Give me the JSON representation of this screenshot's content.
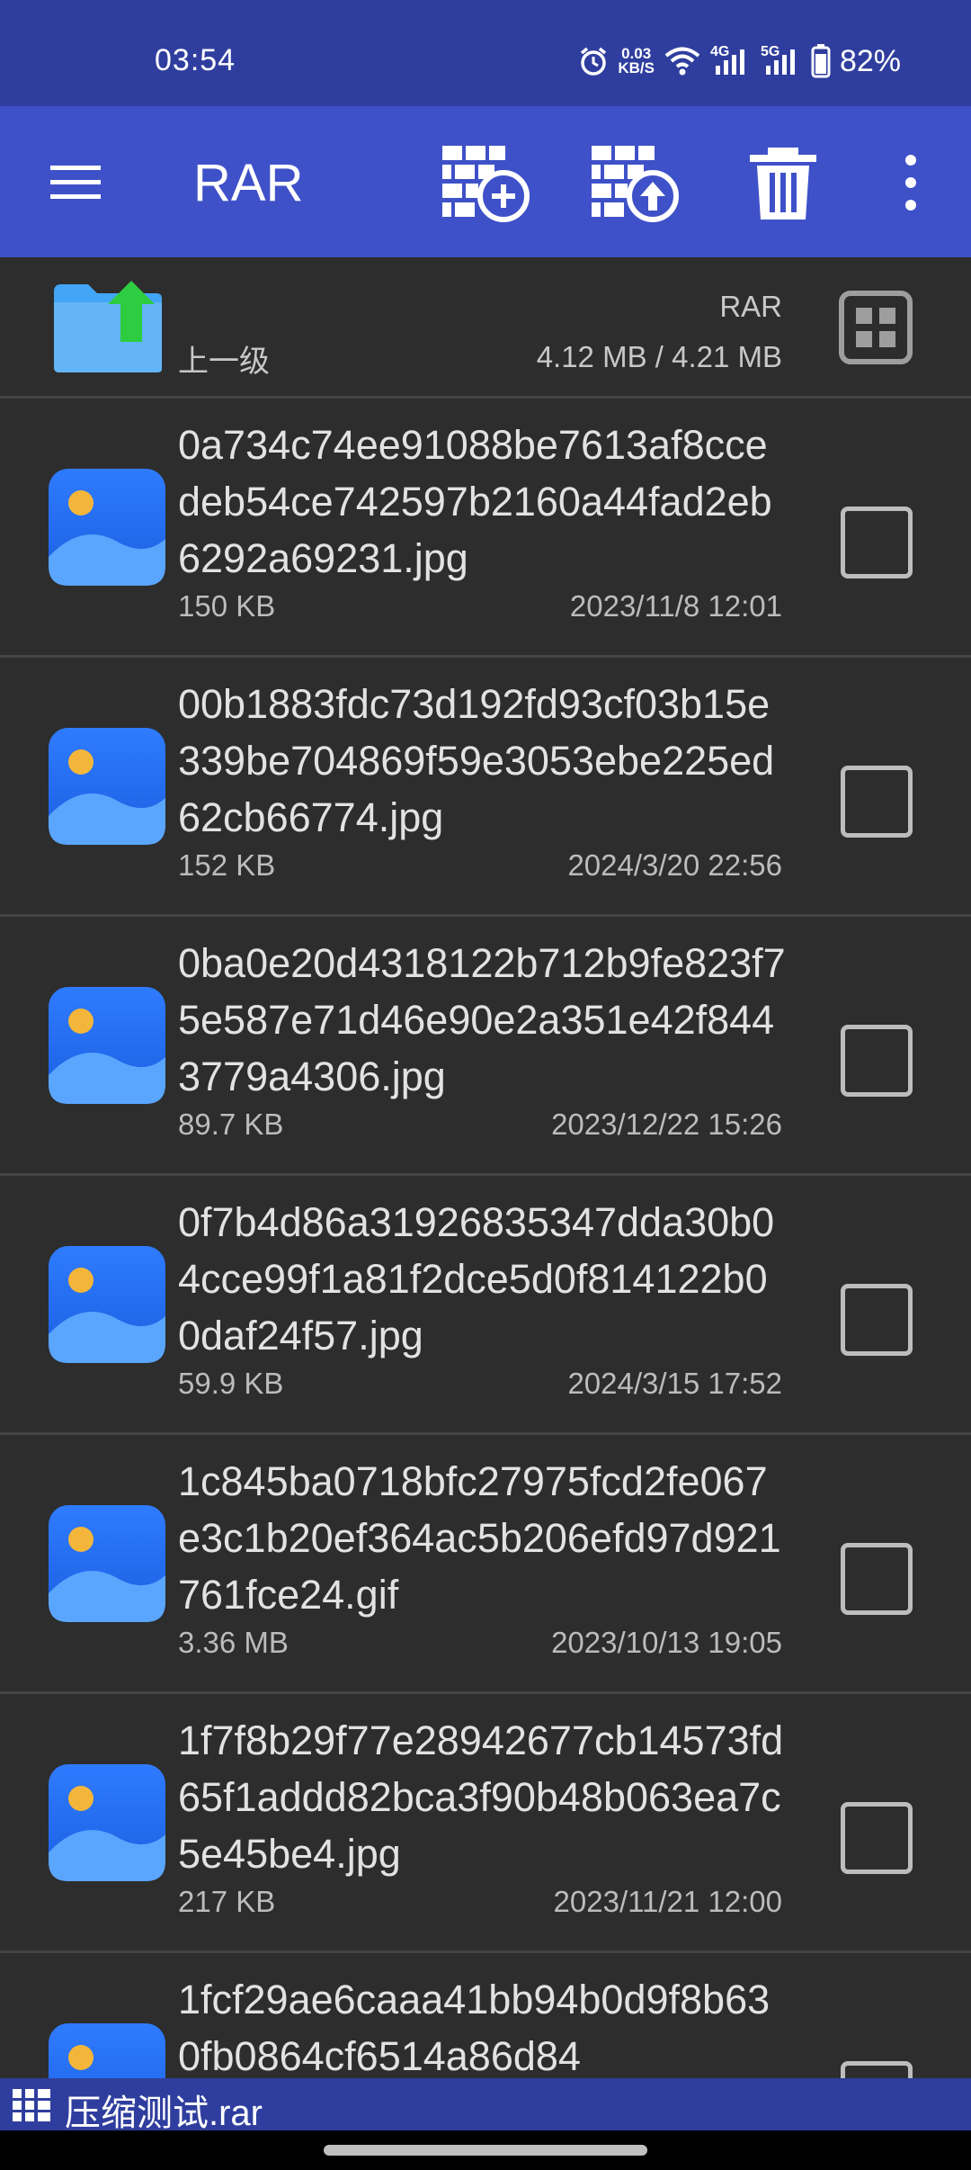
{
  "status": {
    "time": "03:54",
    "net_speed_value": "0.03",
    "net_speed_unit": "KB/S",
    "net_4g": "4G",
    "net_5g": "5G",
    "battery": "82%"
  },
  "toolbar": {
    "title": "RAR",
    "icons": [
      "menu-icon",
      "add-to-archive-icon",
      "extract-icon",
      "delete-icon",
      "more-icon"
    ]
  },
  "parent": {
    "label": "上一级",
    "archive_name": "RAR",
    "sizes": "4.12 MB / 4.21 MB"
  },
  "files": [
    {
      "name": "0a734c74ee91088be7613af8ccedeb54ce742597b2160a44fad2eb6292a69231.jpg",
      "size": "150 KB",
      "date": "2023/11/8 12:01"
    },
    {
      "name": "00b1883fdc73d192fd93cf03b15e339be704869f59e3053ebe225ed62cb66774.jpg",
      "size": "152 KB",
      "date": "2024/3/20 22:56"
    },
    {
      "name": "0ba0e20d4318122b712b9fe823f75e587e71d46e90e2a351e42f8443779a4306.jpg",
      "size": "89.7 KB",
      "date": "2023/12/22 15:26"
    },
    {
      "name": "0f7b4d86a31926835347dda30b04cce99f1a81f2dce5d0f814122b00daf24f57.jpg",
      "size": "59.9 KB",
      "date": "2024/3/15 17:52"
    },
    {
      "name": "1c845ba0718bfc27975fcd2fe067e3c1b20ef364ac5b206efd97d921761fce24.gif",
      "size": "3.36 MB",
      "date": "2023/10/13 19:05"
    },
    {
      "name": "1f7f8b29f77e28942677cb14573fd65f1addd82bca3f90b48b063ea7c5e45be4.jpg",
      "size": "217 KB",
      "date": "2023/11/21 12:00"
    },
    {
      "name": "1fcf29ae6caaa41bb94b0d9f8b630fb0864cf6514a86d84",
      "size": "",
      "date": ""
    }
  ],
  "bottom": {
    "archive_path": "压缩测试.rar"
  },
  "colors": {
    "status_bar": "#2f3e9e",
    "toolbar": "#3f51c8",
    "background": "#2d2d2d",
    "folder": "#42a5f5",
    "folder_arrow": "#2ecc40"
  }
}
